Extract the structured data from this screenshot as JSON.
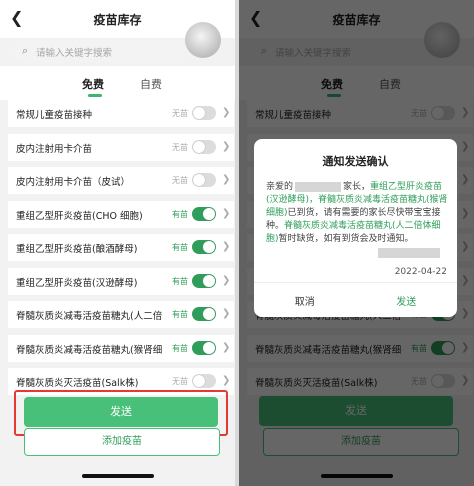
{
  "header": {
    "back_icon": "chevron-left-icon",
    "title": "疫苗库存"
  },
  "search": {
    "placeholder": "请输入关键字搜索"
  },
  "tabs": [
    {
      "label": "免费",
      "active": true
    },
    {
      "label": "自费",
      "active": false
    }
  ],
  "list": [
    {
      "name": "常规儿童疫苗接种",
      "status": "无苗",
      "enabled": false
    },
    {
      "name": "皮内注射用卡介苗",
      "status": "无苗",
      "enabled": false
    },
    {
      "name": "皮内注射用卡介苗（皮试）",
      "status": "无苗",
      "enabled": false
    },
    {
      "name": "重组乙型肝炎疫苗(CHO 细胞)",
      "status": "有苗",
      "enabled": true
    },
    {
      "name": "重组乙型肝炎疫苗(酿酒酵母)",
      "status": "有苗",
      "enabled": true
    },
    {
      "name": "重组乙型肝炎疫苗(汉逊酵母)",
      "status": "有苗",
      "enabled": true
    },
    {
      "name": "脊髓灰质炎减毒活疫苗糖丸(人二倍",
      "status": "有苗",
      "enabled": true
    },
    {
      "name": "脊髓灰质炎减毒活疫苗糖丸(猴肾细",
      "status": "有苗",
      "enabled": true
    },
    {
      "name": "脊髓灰质炎灭活疫苗(Salk株)",
      "status": "无苗",
      "enabled": false
    }
  ],
  "buttons": {
    "send": "发送",
    "add": "添加疫苗"
  },
  "dialog": {
    "title": "通知发送确认",
    "greeting": "亲爱的",
    "parent": "家长，",
    "vaccines_in_stock": "重组乙型肝炎疫苗(汉逊酵母)，脊髓灰质炎减毒活疫苗糖丸(猴肾细胞)",
    "in_stock_suffix": "已到货，请有需要的家长尽快带宝宝接种。",
    "vaccines_out": "脊髓灰质炎减毒活疫苗糖丸(人二倍体细胞)",
    "out_suffix": "暂时缺货，如有到货会及时通知。",
    "date": "2022-04-22",
    "cancel": "取消",
    "confirm": "发送"
  },
  "colors": {
    "accent": "#2e9e5a",
    "button": "#48c07a",
    "highlight_border": "#e53935"
  }
}
